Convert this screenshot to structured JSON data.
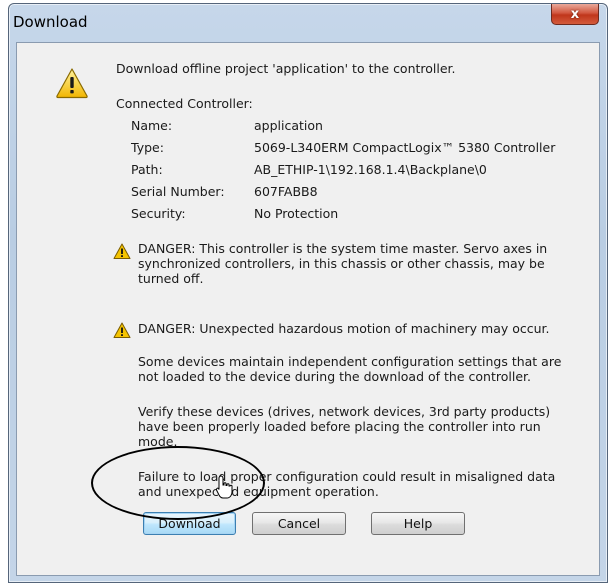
{
  "window": {
    "title": "Download",
    "close_glyph": "x"
  },
  "message": {
    "header": "Download offline project 'application' to the controller.",
    "section_label": "Connected Controller:",
    "fields": [
      {
        "label": "Name:",
        "value": "application"
      },
      {
        "label": "Type:",
        "value": "5069-L340ERM CompactLogix™ 5380 Controller"
      },
      {
        "label": "Path:",
        "value": "AB_ETHIP-1\\192.168.1.4\\Backplane\\0"
      },
      {
        "label": "Serial Number:",
        "value": "607FABB8"
      },
      {
        "label": "Security:",
        "value": "No Protection"
      }
    ],
    "danger_1": "DANGER: This controller is the system time master.  Servo axes in\nsynchronized controllers, in this chassis or other chassis, may be\nturned off.",
    "danger_2": "DANGER: Unexpected hazardous motion of machinery may occur.",
    "para_1": "Some devices maintain independent configuration settings that are\nnot loaded to the device during the download of the controller.",
    "para_2": "Verify these devices (drives, network devices, 3rd party products)\nhave been properly loaded before placing the controller into run\nmode.",
    "para_3": "Failure to load proper configuration could result in misaligned data\nand unexpected equipment operation."
  },
  "buttons": {
    "download": "Download",
    "cancel": "Cancel",
    "help": "Help"
  },
  "icons": {
    "large_warning": "warning-icon",
    "small_warning": "warning-icon",
    "cursor": "mouse-pointer-icon"
  },
  "colors": {
    "warning_fill": "#f5c400",
    "close_button": "#c9452a",
    "default_button_border": "#3c7fb1"
  }
}
